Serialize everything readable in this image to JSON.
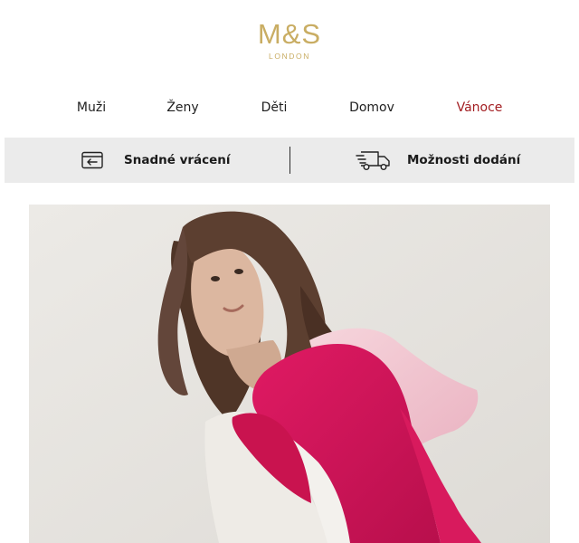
{
  "brand": {
    "name": "M&S",
    "sub": "LONDON",
    "color": "#c9ad63"
  },
  "nav": {
    "items": [
      {
        "label": "Muži"
      },
      {
        "label": "Ženy"
      },
      {
        "label": "Děti"
      },
      {
        "label": "Domov"
      },
      {
        "label": "Vánoce"
      }
    ],
    "highlight_color": "#a31e22"
  },
  "services": [
    {
      "label": "Snadné vrácení",
      "icon": "easy-returns-icon"
    },
    {
      "label": "Možnosti dodání",
      "icon": "delivery-truck-icon"
    }
  ],
  "hero": {
    "colors": {
      "background": "#e8e6e2",
      "hoodie": "#d4145a",
      "hood": "#f3c8d3",
      "jacket": "#eeebe6",
      "hair": "#5c3f30",
      "skin": "#dcb7a0"
    }
  }
}
